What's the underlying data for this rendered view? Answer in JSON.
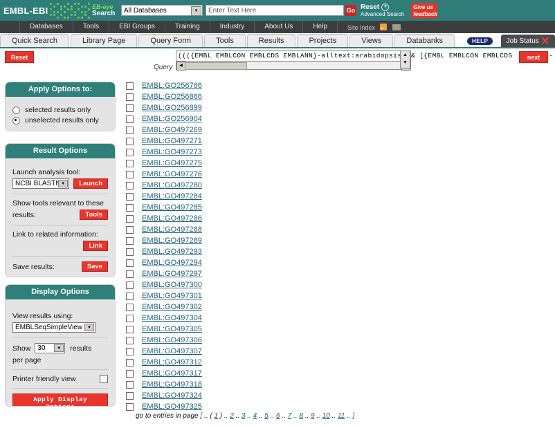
{
  "banner": {
    "logo_text": "EMBL-EBI",
    "ebeye_top": "EB-eye",
    "ebeye_bottom": "Search",
    "database_select_value": "All Databases",
    "search_placeholder": "Enter Text Here",
    "search_value": "",
    "go_label": "Go",
    "reset_label": "Reset",
    "advanced_search_label": "Advanced Search",
    "feedback_line1": "Give us",
    "feedback_line2": "feedback",
    "teal": "#2e7d78",
    "red": "#e8342a"
  },
  "darknav": {
    "items": [
      "Databases",
      "Tools",
      "EBI Groups",
      "Training",
      "Industry",
      "About Us",
      "Help"
    ],
    "site_index_label": "Site Index"
  },
  "tabs": {
    "items": [
      "Quick Search",
      "Library Page",
      "Query Form",
      "Tools",
      "Results",
      "Projects",
      "Views",
      "Databanks"
    ],
    "help_badge": "HELP",
    "job_status": "Job Status"
  },
  "query": {
    "reset_label": "Reset",
    "label": "Query",
    "text": "((({EMBL EMBLCON EMBLCDS EMBLANN}-alltext:arabidopsis",
    "tail_text": "& [{EMBL EMBLCON EMBLCDS",
    "tail_text_after": "}-",
    "next_label": "next",
    "trailing_dash": "-"
  },
  "apply_options": {
    "title": "Apply Options to:",
    "options": [
      {
        "label": "selected results only",
        "selected": false
      },
      {
        "label": "unselected results only",
        "selected": true
      }
    ]
  },
  "result_options": {
    "title": "Result Options",
    "launch_label": "Launch analysis tool:",
    "tool_value": "NCBI BLASTN",
    "launch_button": "Launch",
    "tools_label_line1": "Show tools relevant to these",
    "tools_label_line2": "results:",
    "tools_button": "Tools",
    "link_label": "Link to related information:",
    "link_button": "Link",
    "save_label": "Save results:",
    "save_button": "Save"
  },
  "display_options": {
    "title": "Display Options",
    "view_label": "View results using:",
    "view_value": "EMBLSeqSimpleView",
    "show_label": "Show",
    "show_value": "30",
    "results_label": "results",
    "per_page_label": "per page",
    "printer_label": "Printer friendly view",
    "printer_checked": false,
    "apply_button": "Apply Display Options"
  },
  "results": {
    "items": [
      "EMBL:GO256766",
      "EMBL:GO256866",
      "EMBL:GO256899",
      "EMBL:GO256904",
      "EMBL:GO497269",
      "EMBL:GO497271",
      "EMBL:GO497273",
      "EMBL:GO497275",
      "EMBL:GO497276",
      "EMBL:GO497280",
      "EMBL:GO497284",
      "EMBL:GO497285",
      "EMBL:GO497286",
      "EMBL:GO497288",
      "EMBL:GO497289",
      "EMBL:GO497293",
      "EMBL:GO497294",
      "EMBL:GO497297",
      "EMBL:GO497300",
      "EMBL:GO497301",
      "EMBL:GO497302",
      "EMBL:GO497304",
      "EMBL:GO497305",
      "EMBL:GO497306",
      "EMBL:GO497307",
      "EMBL:GO497312",
      "EMBL:GO497317",
      "EMBL:GO497318",
      "EMBL:GO497324",
      "EMBL:GO497325"
    ]
  },
  "pagination": {
    "prefix": "go to entries in page",
    "open_bracket": "[",
    "current_page": "1",
    "pages": [
      "2",
      "3",
      "4",
      "5",
      "6",
      "7",
      "8",
      "9",
      "10",
      "11"
    ],
    "close_bracket": "]",
    "separator": ".."
  }
}
